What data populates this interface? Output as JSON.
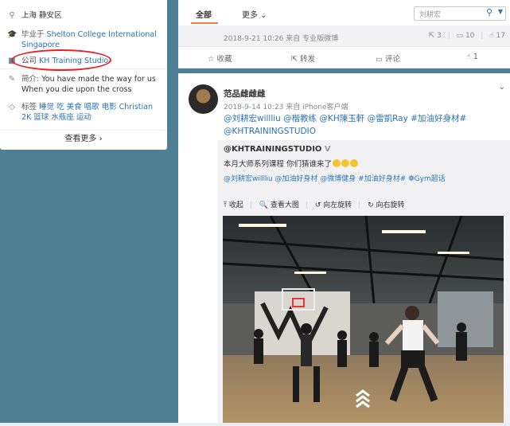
{
  "profile": {
    "location": "上海 静安区",
    "education_prefix": "毕业于",
    "education": "Shelton College International Singapore",
    "company_prefix": "公司",
    "company": "KH Training Studio",
    "bio_label": "简介:",
    "bio": "You have made the way for us When you die upon the cross",
    "tags_label": "标签",
    "tags": "睡觉 吃 美食 唱歌 电影 Christian 2K 篮球 水瓶座 运动",
    "view_more": "查看更多 ›"
  },
  "feed_tabs": {
    "all": "全部",
    "more": "更多 ⌄",
    "search_value": "刘耕宏"
  },
  "post1": {
    "date_source": "2018-9-21 10:26 来自 专业版微博",
    "reposts": "3",
    "comments": "10",
    "likes": "17",
    "actions": {
      "favorite": "收藏",
      "repost": "转发",
      "comment": "评论",
      "like": "1"
    }
  },
  "post2": {
    "author": "范品雌雌雌",
    "date_source": "2018-9-14 10:23 来自 iPhone客户端",
    "text": "@刘耕宏willliu @楷教练 @KH陳玉軒 @雷凱Ray #加油好身材# @KHTRAININGSTUDIO",
    "repost": {
      "author": "@KHTRAININGSTUDIO",
      "text": "本月大师系列课程 你们猜谁来了",
      "mentions": "@刘耕宏willliu @加油好身材 @微博健身 #加油好身材# ❁Gym超话",
      "tools": {
        "collapse": "⤒ 收起",
        "view_large": "🔍 查看大图",
        "rotate_left": "↺ 向左旋转",
        "rotate_right": "↻ 向右旋转"
      }
    }
  },
  "colors": {
    "page_bg": "#4f7f93",
    "link": "#2b73b3",
    "accent_orange": "#fa7d3c",
    "annotation_red": "#e0252a"
  }
}
